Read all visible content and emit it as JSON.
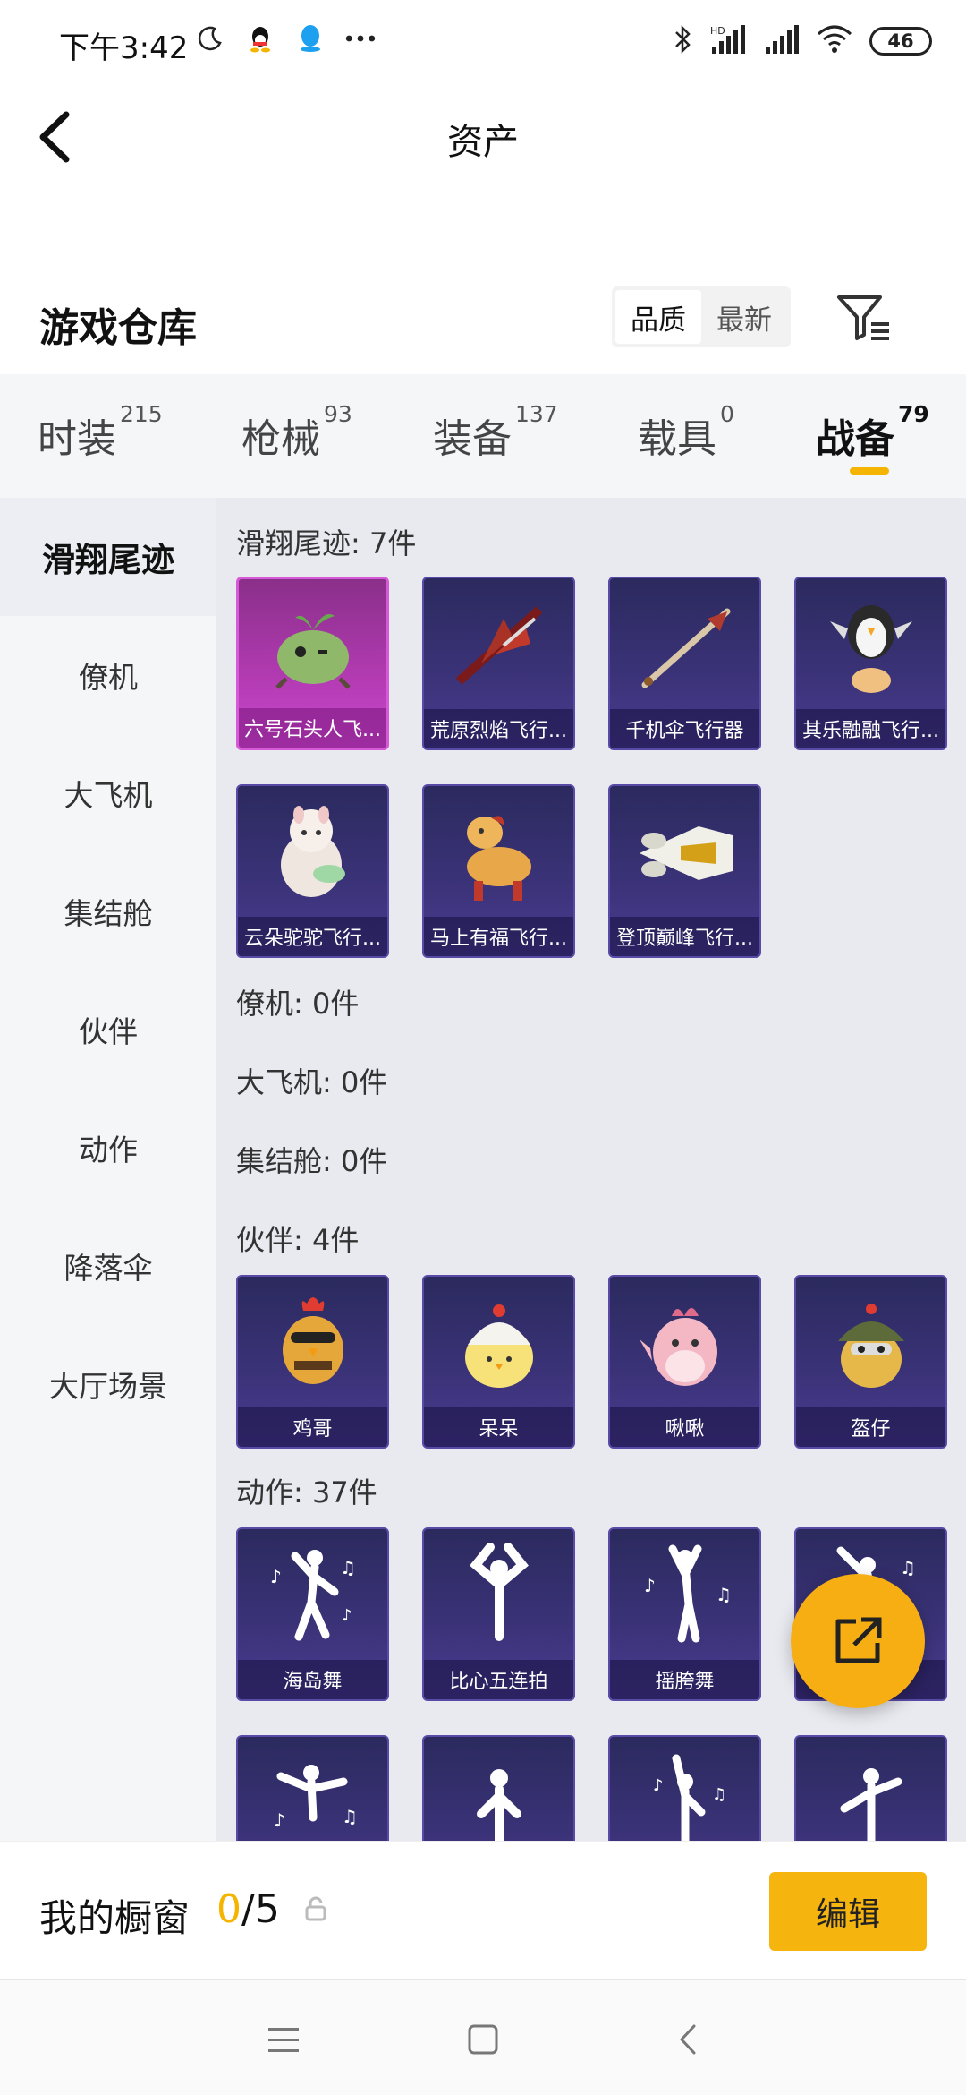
{
  "status_bar": {
    "time": "下午3:42",
    "battery": "46",
    "network_label": "HD"
  },
  "header": {
    "title": "资产",
    "back_label": "返回"
  },
  "warehouse": {
    "title": "游戏仓库",
    "sort_options": [
      "品质",
      "最新"
    ],
    "active_sort": "品质"
  },
  "tabs": [
    {
      "label": "时装",
      "count": "215"
    },
    {
      "label": "枪械",
      "count": "93"
    },
    {
      "label": "装备",
      "count": "137"
    },
    {
      "label": "载具",
      "count": "0"
    },
    {
      "label": "战备",
      "count": "79"
    }
  ],
  "active_tab": "战备",
  "sidebar": {
    "items": [
      "滑翔尾迹",
      "僚机",
      "大飞机",
      "集结舱",
      "伙伴",
      "动作",
      "降落伞",
      "大厅场景"
    ],
    "active": "滑翔尾迹"
  },
  "sections": {
    "glider": {
      "heading": "滑翔尾迹: 7件",
      "items": [
        "六号石头人飞...",
        "荒原烈焰飞行...",
        "千机伞飞行器",
        "其乐融融飞行...",
        "云朵驼驼飞行...",
        "马上有福飞行...",
        "登顶巅峰飞行..."
      ]
    },
    "wingman": {
      "heading": "僚机: 0件"
    },
    "plane": {
      "heading": "大飞机: 0件"
    },
    "pod": {
      "heading": "集结舱: 0件"
    },
    "partner": {
      "heading": "伙伴: 4件",
      "items": [
        "鸡哥",
        "呆呆",
        "啾啾",
        "盔仔"
      ]
    },
    "emote": {
      "heading": "动作: 37件",
      "items": [
        "海岛舞",
        "比心五连拍",
        "摇胯舞",
        "",
        "",
        "",
        "",
        ""
      ]
    }
  },
  "showcase": {
    "title": "我的橱窗",
    "current": "0",
    "separator": "/",
    "total": "5",
    "edit_label": "编辑"
  },
  "colors": {
    "accent": "#f5b400",
    "card_purple": "#3a3277",
    "card_pink": "#b33bb3",
    "fab": "#f6ae12"
  }
}
